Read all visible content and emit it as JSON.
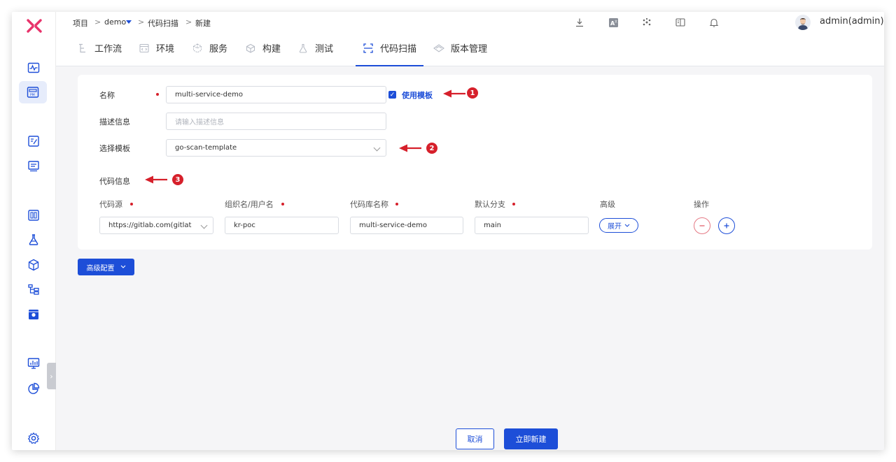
{
  "breadcrumb": {
    "items": [
      "项目",
      "demo",
      "代码扫描",
      "新建"
    ],
    "separator": ">"
  },
  "user": {
    "name": "admin(admin)"
  },
  "tabs": [
    {
      "label": "工作流",
      "icon": "workflow-icon"
    },
    {
      "label": "环境",
      "icon": "environment-icon"
    },
    {
      "label": "服务",
      "icon": "service-icon"
    },
    {
      "label": "构建",
      "icon": "build-icon"
    },
    {
      "label": "测试",
      "icon": "test-icon"
    },
    {
      "label": "代码扫描",
      "icon": "code-scan-icon",
      "active": true
    },
    {
      "label": "版本管理",
      "icon": "version-icon"
    }
  ],
  "form": {
    "name_label": "名称",
    "name_value": "multi-service-demo",
    "use_template_label": "使用模板",
    "use_template_checked": true,
    "desc_label": "描述信息",
    "desc_placeholder": "请输入描述信息",
    "template_label": "选择模板",
    "template_value": "go-scan-template",
    "code_info_label": "代码信息"
  },
  "code_table": {
    "headers": [
      "代码源",
      "组织名/用户名",
      "代码库名称",
      "默认分支",
      "高级",
      "操作"
    ],
    "row": {
      "source": "https://gitlab.com(gitlat",
      "org": "kr-poc",
      "repo": "multi-service-demo",
      "branch": "main",
      "expand_label": "展开"
    }
  },
  "annotations": [
    "1",
    "2",
    "3"
  ],
  "advanced_config_label": "高级配置",
  "footer": {
    "cancel_label": "取消",
    "create_label": "立即新建"
  },
  "colors": {
    "primary": "#1d4ed8",
    "required": "#d6202b",
    "annotation": "#d6202b"
  }
}
